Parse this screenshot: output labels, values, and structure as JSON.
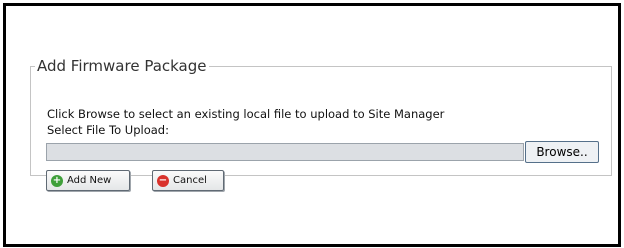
{
  "panel": {
    "title": "Add Firmware Package",
    "instruction": "Click Browse to select an existing local file to upload to Site Manager",
    "file_label": "Select File To Upload:",
    "file_input_value": "",
    "browse_label": "Browse..",
    "add_label": "Add New",
    "cancel_label": "Cancel"
  },
  "colors": {
    "add_icon": "#3f9f3a",
    "cancel_icon": "#d9322c",
    "input_bg": "#dcdfe3"
  },
  "icons": {
    "add": "plus-circle-icon",
    "cancel": "minus-circle-icon"
  }
}
